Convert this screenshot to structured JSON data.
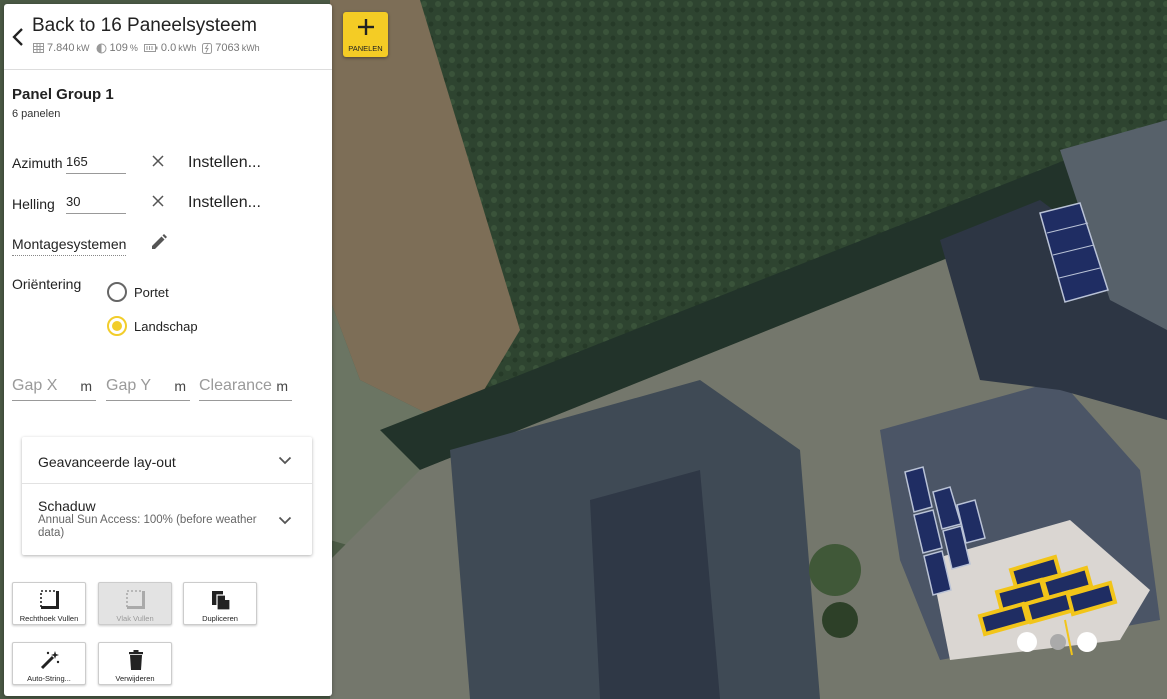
{
  "header": {
    "title": "Back to 16 Paneelsysteem",
    "stats": [
      {
        "icon": "panel-grid-icon",
        "value": "7.840",
        "unit": "kW"
      },
      {
        "icon": "sun-percent-icon",
        "value": "109",
        "unit": "%"
      },
      {
        "icon": "battery-icon",
        "value": "0.0",
        "unit": "kWh"
      },
      {
        "icon": "lightning-icon",
        "value": "7063",
        "unit": "kWh"
      }
    ]
  },
  "group": {
    "title": "Panel Group 1",
    "subtitle": "6 panelen"
  },
  "azimuth": {
    "label": "Azimuth",
    "value": "165",
    "set_label": "Instellen..."
  },
  "tilt": {
    "label": "Helling",
    "value": "30",
    "set_label": "Instellen..."
  },
  "mounting": {
    "label": "Montagesystemen"
  },
  "orientation": {
    "label": "Oriëntering",
    "options": [
      {
        "label": "Portet",
        "selected": false
      },
      {
        "label": "Landschap",
        "selected": true
      }
    ]
  },
  "gaps": {
    "gap_x": {
      "placeholder": "Gap X",
      "unit": "m"
    },
    "gap_y": {
      "placeholder": "Gap Y",
      "unit": "m"
    },
    "clearance": {
      "placeholder": "Clearance",
      "unit": "m"
    }
  },
  "accordion": {
    "advanced_layout": {
      "title": "Geavanceerde lay-out"
    },
    "shade": {
      "title": "Schaduw",
      "subtitle": "Annual Sun Access: 100% (before weather data)"
    }
  },
  "tools": {
    "rect_fill": "Rechthoek Vullen",
    "area_fill": "Vlak Vullen",
    "duplicate": "Dupliceren",
    "auto_string": "Auto-String...",
    "delete": "Verwijderen"
  },
  "add_panels": {
    "label": "PANELEN"
  },
  "colors": {
    "accent": "#f4cc25",
    "radio_selected": "#f2cd2b",
    "panel_selected_outline": "#f2c519",
    "panel_fill": "#1f2d63"
  }
}
